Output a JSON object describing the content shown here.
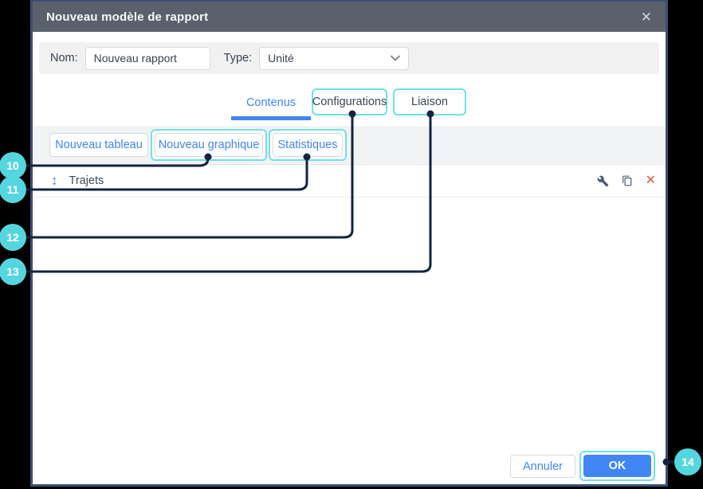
{
  "dialog": {
    "title": "Nouveau modèle de rapport",
    "close_glyph": "✕",
    "form": {
      "name_label": "Nom:",
      "name_value": "Nouveau rapport",
      "type_label": "Type:",
      "type_value": "Unité"
    },
    "tabs": [
      {
        "label": "Contenus",
        "active": true
      },
      {
        "label": "Configurations",
        "active": false,
        "highlighted": true
      },
      {
        "label": "Liaison",
        "active": false,
        "highlighted": true
      }
    ],
    "toolbar": [
      {
        "label": "Nouveau tableau"
      },
      {
        "label": "Nouveau graphique",
        "highlighted": true
      },
      {
        "label": "Statistiques",
        "highlighted": true
      }
    ],
    "list": {
      "items": [
        {
          "label": "Trajets",
          "move_glyph": "↕",
          "actions": [
            "configure",
            "duplicate",
            "delete"
          ],
          "delete_glyph": "✕"
        }
      ]
    },
    "footer": {
      "cancel_label": "Annuler",
      "ok_label": "OK"
    }
  },
  "callouts": [
    {
      "number": "10",
      "target": "nouveau-graphique-button"
    },
    {
      "number": "11",
      "target": "statistiques-button"
    },
    {
      "number": "12",
      "target": "configurations-tab"
    },
    {
      "number": "13",
      "target": "liaison-tab"
    },
    {
      "number": "14",
      "target": "ok-button"
    }
  ],
  "colors": {
    "accent_blue": "#4285f4",
    "highlight_cyan": "#6fe0e6",
    "callout_fill": "#55d6de",
    "callout_line": "#14233f",
    "header_bg": "#5a616c",
    "danger_red": "#e8544d",
    "dialog_border": "#3c4f72"
  }
}
